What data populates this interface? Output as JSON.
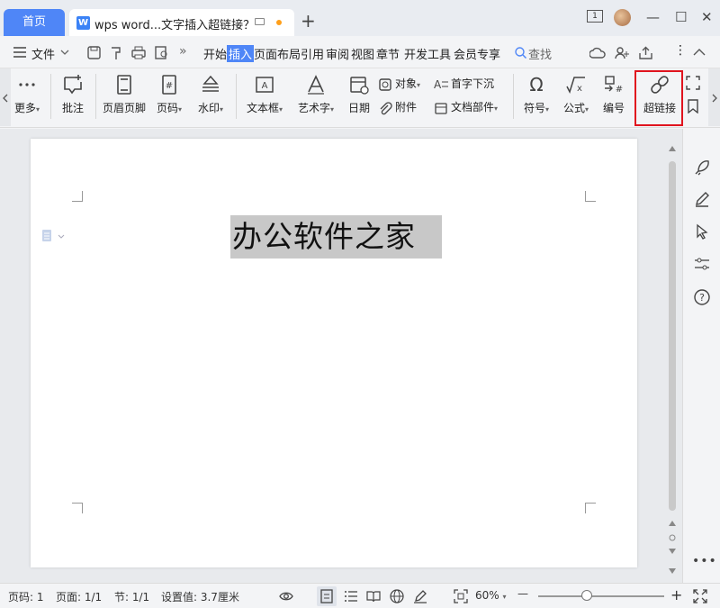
{
  "titlebar": {
    "home_tab": "首页",
    "doc_tab_title": "wps word...文字插入超链接？",
    "doc_tab_icon": "W",
    "add_tab": "+",
    "badge": "1",
    "minimize": "—",
    "maximize": "☐",
    "close": "✕"
  },
  "menubar": {
    "file": "文件",
    "more": "»",
    "tabs": [
      "开始",
      "插入",
      "页面布局",
      "引用",
      "审阅",
      "视图",
      "章节",
      "开发工具",
      "会员专享"
    ],
    "active_tab": "插入",
    "search": "查找"
  },
  "ribbon": {
    "more": "更多",
    "comment": "批注",
    "header_footer": "页眉页脚",
    "page_number": "页码",
    "watermark": "水印",
    "textbox": "文本框",
    "wordart": "艺术字",
    "date": "日期",
    "object": "对象",
    "attachment": "附件",
    "dropcap": "首字下沉",
    "doc_parts": "文档部件",
    "symbol": "符号",
    "formula": "公式",
    "numbering": "编号",
    "hyperlink": "超链接",
    "hyperlink_highlight_color": "#e0141e",
    "dropdown_arrow": "▾"
  },
  "document": {
    "text": "办公软件之家",
    "selection_color": "#c8c8c8"
  },
  "statusbar": {
    "page_num": "页码: 1",
    "pages": "页面: 1/1",
    "section": "节: 1/1",
    "setting": "设置值: 3.7厘米",
    "zoom": "60%",
    "zoom_fraction": 0.6,
    "minus": "—",
    "plus": "+"
  },
  "colors": {
    "accent": "#4f86f7",
    "highlight_red": "#e0141e"
  }
}
